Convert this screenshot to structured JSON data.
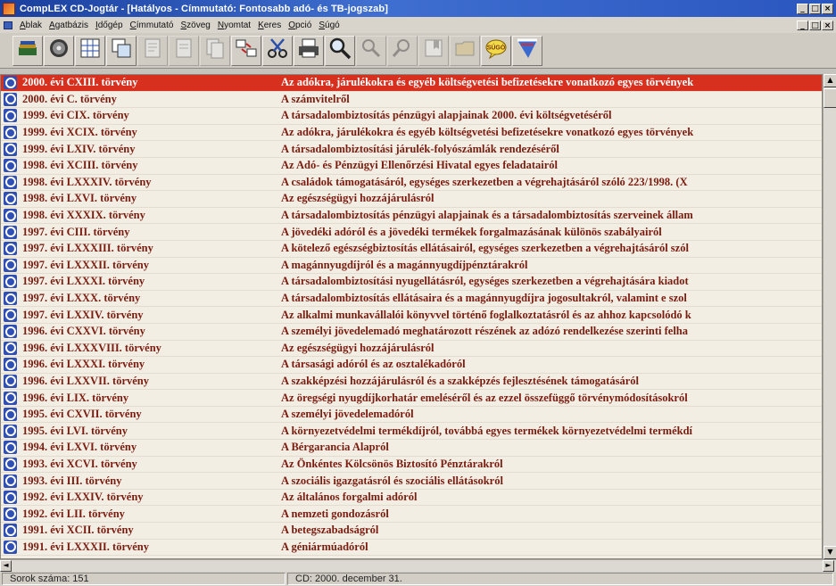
{
  "window": {
    "title": "CompLEX CD-Jogtár - [Hatályos - Címmutató: Fontosabb adó- és TB-jogszab]",
    "minimize": "_",
    "maximize": "□",
    "close": "×"
  },
  "menu": [
    {
      "hot": "A",
      "rest": "blak"
    },
    {
      "hot": "A",
      "rest": "gatbázis"
    },
    {
      "hot": "I",
      "rest": "dőgép"
    },
    {
      "hot": "C",
      "rest": "ímmutató"
    },
    {
      "hot": "S",
      "rest": "zöveg"
    },
    {
      "hot": "N",
      "rest": "yomtat"
    },
    {
      "hot": "K",
      "rest": "eres"
    },
    {
      "hot": "O",
      "rest": "pció"
    },
    {
      "hot": "S",
      "rest": "úgó"
    }
  ],
  "toolbar": {
    "buttons": [
      {
        "name": "books-icon",
        "enabled": true
      },
      {
        "name": "cd-icon",
        "enabled": true
      },
      {
        "name": "grid-view-icon",
        "enabled": true
      },
      {
        "name": "windows-icon",
        "enabled": true
      },
      {
        "name": "document-icon",
        "enabled": false
      },
      {
        "name": "page-icon",
        "enabled": false
      },
      {
        "name": "copy-page-icon",
        "enabled": false
      },
      {
        "name": "transfer-icon",
        "enabled": true
      },
      {
        "name": "scissors-icon",
        "enabled": true
      },
      {
        "name": "printer-icon",
        "enabled": true
      },
      {
        "name": "magnifier-icon",
        "enabled": true
      },
      {
        "name": "search-next-icon",
        "enabled": false
      },
      {
        "name": "search-prev-icon",
        "enabled": false
      },
      {
        "name": "bookmark-icon",
        "enabled": false
      },
      {
        "name": "folder-icon",
        "enabled": false
      },
      {
        "name": "help-bubble-icon",
        "enabled": true,
        "label": "SÚGÓ"
      },
      {
        "name": "flags-icon",
        "enabled": true
      }
    ]
  },
  "rows": [
    {
      "law": "2000. évi CXIII. törvény",
      "subject": "Az adókra, járulékokra és egyéb költségvetési befizetésekre vonatkozó egyes törvények",
      "selected": true
    },
    {
      "law": "2000. évi C. törvény",
      "subject": "A számvitelről"
    },
    {
      "law": "1999. évi CIX. törvény",
      "subject": "A társadalombiztosítás pénzügyi alapjainak 2000. évi költségvetéséről"
    },
    {
      "law": "1999. évi XCIX. törvény",
      "subject": "Az adókra, járulékokra és egyéb költségvetési befizetésekre vonatkozó egyes törvények"
    },
    {
      "law": "1999. évi LXIV. törvény",
      "subject": "A társadalombiztosítási járulék-folyószámlák rendezéséről"
    },
    {
      "law": "1998. évi XCIII. törvény",
      "subject": "Az Adó- és Pénzügyi Ellenőrzési Hivatal egyes feladatairól"
    },
    {
      "law": "1998. évi LXXXIV. törvény",
      "subject": "A családok támogatásáról, egységes szerkezetben a végrehajtásáról szóló 223/1998. (X"
    },
    {
      "law": "1998. évi LXVI. törvény",
      "subject": "Az egészségügyi hozzájárulásról"
    },
    {
      "law": "1998. évi XXXIX. törvény",
      "subject": "A társadalombiztosítás pénzügyi alapjainak és a társadalombiztosítás szerveinek állam"
    },
    {
      "law": "1997. évi CIII. törvény",
      "subject": "A jövedéki adóról és a jövedéki termékek forgalmazásának különös szabályairól"
    },
    {
      "law": "1997. évi LXXXIII. törvény",
      "subject": "A kötelező egészségbiztosítás ellátásairól, egységes szerkezetben a végrehajtásáról szól"
    },
    {
      "law": "1997. évi LXXXII. törvény",
      "subject": "A magánnyugdíjról és a magánnyugdíjpénztárakról"
    },
    {
      "law": "1997. évi LXXXI. törvény",
      "subject": "A társadalombiztosítási nyugellátásról, egységes szerkezetben a végrehajtására kiadot"
    },
    {
      "law": "1997. évi LXXX. törvény",
      "subject": "A társadalombiztosítás ellátásaira és a magánnyugdíjra jogosultakról, valamint e szol"
    },
    {
      "law": "1997. évi LXXIV. törvény",
      "subject": "Az alkalmi munkavállalói könyvvel történő foglalkoztatásról és az ahhoz kapcsolódó k"
    },
    {
      "law": "1996. évi CXXVI. törvény",
      "subject": "A személyi jövedelemadó meghatározott részének az adózó rendelkezése szerinti felha"
    },
    {
      "law": "1996. évi LXXXVIII. törvény",
      "subject": "Az egészségügyi hozzájárulásról"
    },
    {
      "law": "1996. évi LXXXI. törvény",
      "subject": "A társasági adóról és az osztalékadóról"
    },
    {
      "law": "1996. évi LXXVII. törvény",
      "subject": "A szakképzési hozzájárulásról és a szakképzés fejlesztésének támogatásáról"
    },
    {
      "law": "1996. évi LIX. törvény",
      "subject": "Az öregségi nyugdíjkorhatár emeléséről és az ezzel összefüggő törvénymódosításokról"
    },
    {
      "law": "1995. évi CXVII. törvény",
      "subject": "A személyi jövedelemadóról"
    },
    {
      "law": "1995. évi LVI. törvény",
      "subject": "A környezetvédelmi termékdíjról, továbbá egyes termékek környezetvédelmi termékdí"
    },
    {
      "law": "1994. évi LXVI. törvény",
      "subject": "A Bérgarancia Alapról"
    },
    {
      "law": "1993. évi XCVI. törvény",
      "subject": "Az Önkéntes Kölcsönös Biztosító Pénztárakról"
    },
    {
      "law": "1993. évi III. törvény",
      "subject": "A szociális igazgatásról és szociális ellátásokról"
    },
    {
      "law": "1992. évi LXXIV. törvény",
      "subject": "Az általános forgalmi adóról"
    },
    {
      "law": "1992. évi LII. törvény",
      "subject": "A nemzeti gondozásról"
    },
    {
      "law": "1991. évi XCII. törvény",
      "subject": "A betegszabadságról"
    },
    {
      "law": "1991. évi LXXXII. törvény",
      "subject": "A géniármúadóról"
    }
  ],
  "scroll": {
    "up": "▲",
    "down": "▼",
    "left": "◄",
    "right": "►"
  },
  "status": {
    "rows_count": "Sorok száma: 151",
    "cd_date": "CD: 2000. december 31."
  },
  "colors": {
    "selection": "#d8301e",
    "row_text": "#7a1c10",
    "title_bar": "#2a56bf",
    "list_background": "#f3eee3"
  }
}
